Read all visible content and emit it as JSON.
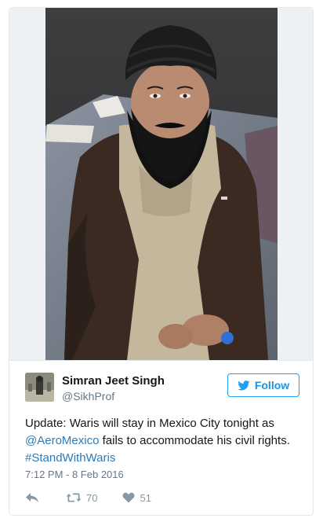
{
  "tweet": {
    "author": {
      "name": "Simran Jeet Singh",
      "handle": "@SikhProf"
    },
    "follow_label": "Follow",
    "text": {
      "part1": "Update: Waris will stay in Mexico City tonight as ",
      "mention": "@AeroMexico",
      "part2": " fails to accommodate his civil rights. ",
      "hashtag": "#StandWithWaris"
    },
    "timestamp": "7:12 PM - 8 Feb 2016",
    "actions": {
      "retweet_count": "70",
      "like_count": "51"
    }
  },
  "icons": {
    "follow": "twitter-bird-icon",
    "reply": "reply-arrow-icon",
    "retweet": "retweet-icon",
    "like": "heart-icon"
  },
  "colors": {
    "accent": "#1da1f2",
    "link": "#2b7bb9",
    "muted": "#8899a6",
    "text": "#14171a"
  }
}
